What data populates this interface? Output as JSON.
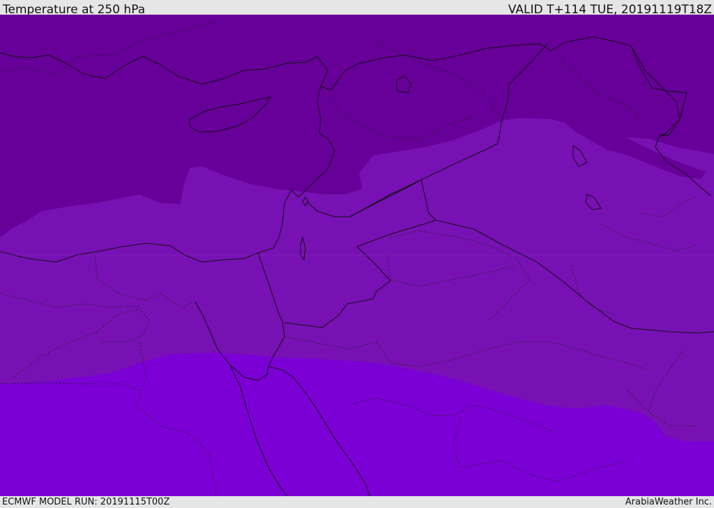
{
  "header": {
    "title": "Temperature at 250 hPa",
    "valid": "VALID T+114 TUE, 20191119T18Z"
  },
  "footer": {
    "model_run": "ECMWF MODEL RUN: 20191115T00Z",
    "credit": "ArabiaWeather Inc."
  },
  "map": {
    "field": "temperature_250hPa",
    "color_bands": [
      {
        "name": "coldest",
        "color": "#660099"
      },
      {
        "name": "middle",
        "color": "#7711b3"
      },
      {
        "name": "warmest",
        "color": "#7b00d6"
      }
    ],
    "border_color": "#111111"
  }
}
